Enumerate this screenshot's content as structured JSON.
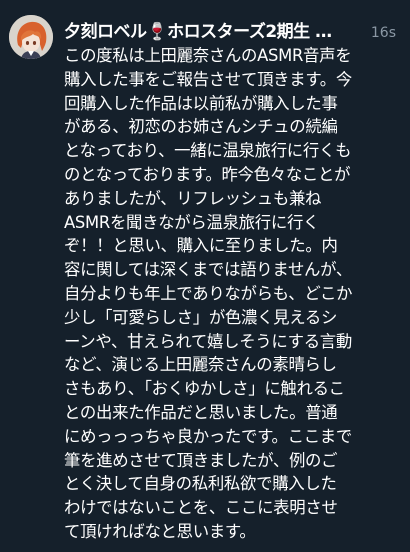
{
  "post": {
    "display_name": "夕刻ロベル🍷ホロスターズ2期生 …",
    "time": "16s",
    "avatar_icon": "user-avatar",
    "text_lines": [
      "この度私は上田麗奈さんのASMR音声を",
      "購入した事をご報告させて頂きます。今",
      "回購入した作品は以前私が購入した事",
      "がある、初恋のお姉さんシチュの続編",
      "となっており、一緒に温泉旅行に行くも",
      "のとなっております。昨今色々なことが",
      "ありましたが、リフレッシュも兼ね",
      "ASMRを聞きながら温泉旅行に行く",
      "ぞ！！と思い、購入に至りました。内",
      "容に関しては深くまでは語りませんが、",
      "自分よりも年上でありながらも、どこか",
      "少し「可愛らしさ」が色濃く見えるシ",
      "ーンや、甘えられて嬉しそうにする言動",
      "など、演じる上田麗奈さんの素晴らし",
      "さもあり、「おくゆかしさ」に触れるこ",
      "との出来た作品だと思いました。普通",
      "にめっっっちゃ良かったです。ここまで",
      "筆を進めさせて頂きましたが、例のご",
      "とく決して自身の私利私欲で購入した",
      "わけではないことを、ここに表明させ",
      "て頂ければなと思います。"
    ]
  },
  "colors": {
    "background": "#15202b",
    "text": "#ffffff",
    "secondary_text": "#8b98a5"
  }
}
